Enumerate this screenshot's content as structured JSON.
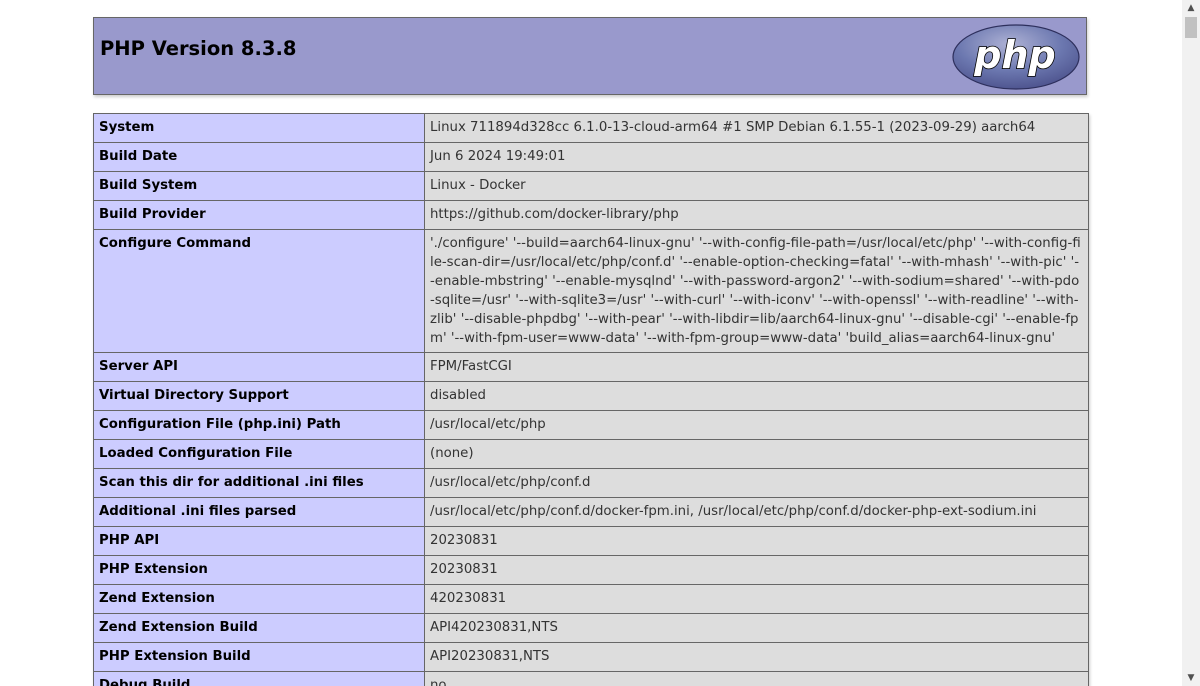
{
  "header": {
    "title": "PHP Version 8.3.8",
    "logo_text": "php"
  },
  "rows": [
    {
      "label": "System",
      "value": "Linux 711894d328cc 6.1.0-13-cloud-arm64 #1 SMP Debian 6.1.55-1 (2023-09-29) aarch64"
    },
    {
      "label": "Build Date",
      "value": "Jun 6 2024 19:49:01"
    },
    {
      "label": "Build System",
      "value": "Linux - Docker"
    },
    {
      "label": "Build Provider",
      "value": "https://github.com/docker-library/php"
    },
    {
      "label": "Configure Command",
      "value": "'./configure' '--build=aarch64-linux-gnu' '--with-config-file-path=/usr/local/etc/php' '--with-config-file-scan-dir=/usr/local/etc/php/conf.d' '--enable-option-checking=fatal' '--with-mhash' '--with-pic' '--enable-mbstring' '--enable-mysqlnd' '--with-password-argon2' '--with-sodium=shared' '--with-pdo-sqlite=/usr' '--with-sqlite3=/usr' '--with-curl' '--with-iconv' '--with-openssl' '--with-readline' '--with-zlib' '--disable-phpdbg' '--with-pear' '--with-libdir=lib/aarch64-linux-gnu' '--disable-cgi' '--enable-fpm' '--with-fpm-user=www-data' '--with-fpm-group=www-data' 'build_alias=aarch64-linux-gnu'"
    },
    {
      "label": "Server API",
      "value": "FPM/FastCGI"
    },
    {
      "label": "Virtual Directory Support",
      "value": "disabled"
    },
    {
      "label": "Configuration File (php.ini) Path",
      "value": "/usr/local/etc/php"
    },
    {
      "label": "Loaded Configuration File",
      "value": "(none)"
    },
    {
      "label": "Scan this dir for additional .ini files",
      "value": "/usr/local/etc/php/conf.d"
    },
    {
      "label": "Additional .ini files parsed",
      "value": "/usr/local/etc/php/conf.d/docker-fpm.ini, /usr/local/etc/php/conf.d/docker-php-ext-sodium.ini"
    },
    {
      "label": "PHP API",
      "value": "20230831"
    },
    {
      "label": "PHP Extension",
      "value": "20230831"
    },
    {
      "label": "Zend Extension",
      "value": "420230831"
    },
    {
      "label": "Zend Extension Build",
      "value": "API420230831,NTS"
    },
    {
      "label": "PHP Extension Build",
      "value": "API20230831,NTS"
    },
    {
      "label": "Debug Build",
      "value": "no"
    }
  ],
  "colors": {
    "header_bg": "#9999cc",
    "label_bg": "#ccccff",
    "value_bg": "#dddddd",
    "border": "#666666"
  }
}
